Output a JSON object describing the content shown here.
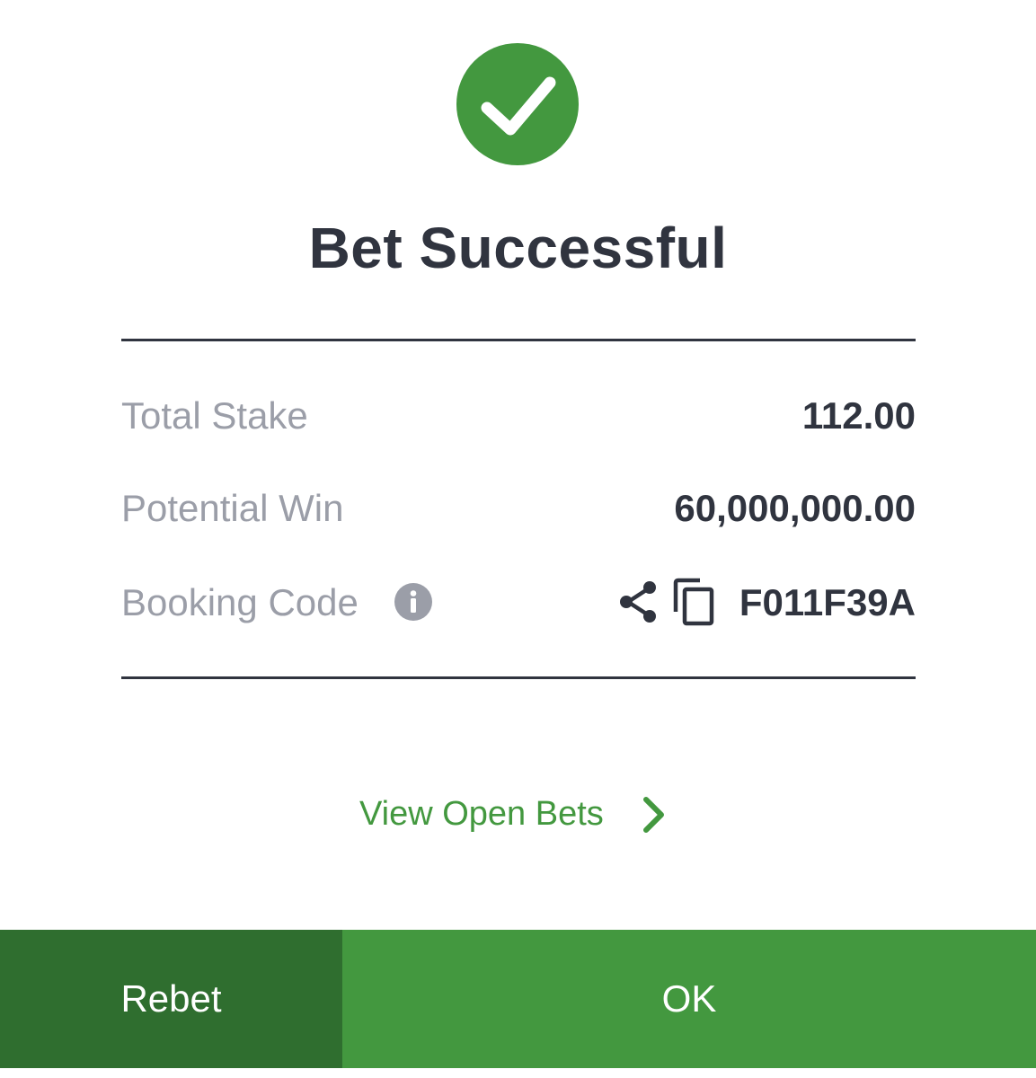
{
  "dialog": {
    "status_icon": "check-circle-icon",
    "title": "Bet Successful",
    "summary": {
      "total_stake_label": "Total Stake",
      "total_stake_value": "112.00",
      "potential_win_label": "Potential Win",
      "potential_win_value": "60,000,000.00",
      "booking_code_label": "Booking Code",
      "booking_code_value": "F011F39A",
      "booking_code_icons": [
        "info-icon",
        "share-icon",
        "copy-icon"
      ]
    },
    "view_open_bets_label": "View Open Bets",
    "buttons": {
      "rebet_label": "Rebet",
      "ok_label": "OK"
    }
  },
  "colors": {
    "brand_green": "#43983f",
    "dark_green": "#2f6e2f",
    "text_dark": "#30343f",
    "text_muted": "#9b9ea8",
    "background": "#ffffff"
  }
}
